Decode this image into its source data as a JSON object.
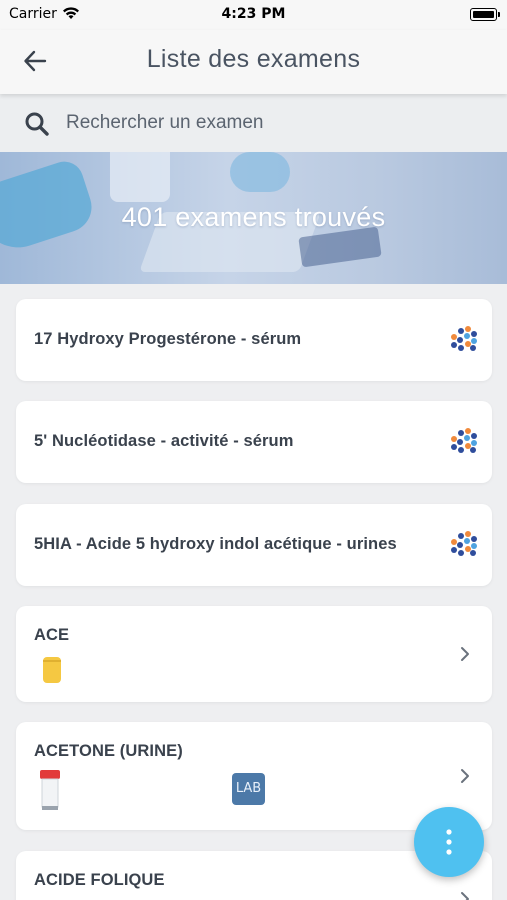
{
  "status_bar": {
    "carrier": "Carrier",
    "time": "4:23 PM"
  },
  "nav": {
    "title": "Liste des examens",
    "back_icon": "arrow-left-icon"
  },
  "search": {
    "placeholder": "Rechercher un examen",
    "value": "",
    "icon": "search-icon"
  },
  "banner": {
    "count_text": "401 examens trouvés"
  },
  "exams": [
    {
      "label": "17 Hydroxy Progestérone - sérum",
      "icon": "dots-logo-icon"
    },
    {
      "label": "5' Nucléotidase - activité - sérum",
      "icon": "dots-logo-icon"
    },
    {
      "label": "5HIA - Acide 5 hydroxy indol acétique - urines",
      "icon": "dots-logo-icon"
    },
    {
      "label": "ACE",
      "icon": "chevron-right-icon",
      "tube": "yellow-tube-icon"
    },
    {
      "label": "ACETONE (URINE)",
      "icon": "chevron-right-icon",
      "tube": "red-cap-tube-icon",
      "badge": "LAB"
    },
    {
      "label": "ACIDE FOLIQUE",
      "icon": "chevron-right-icon"
    }
  ],
  "fab": {
    "icon": "kebab-menu-icon"
  },
  "colors": {
    "accent": "#4fc1f0",
    "lab_badge": "#4c79a8",
    "background": "#eeeff1"
  }
}
